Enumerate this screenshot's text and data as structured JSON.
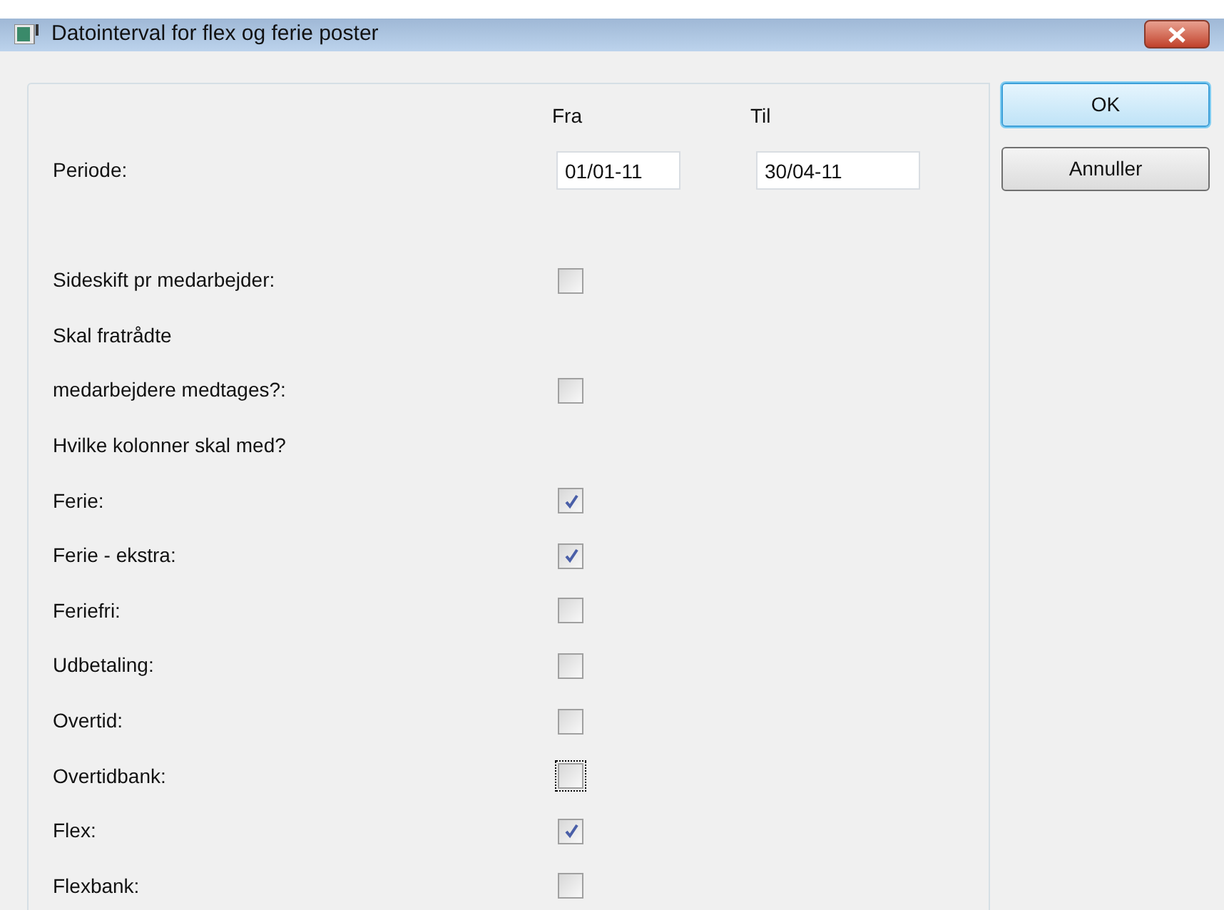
{
  "window": {
    "title": "Datointerval for flex og ferie poster"
  },
  "period": {
    "label": "Periode:",
    "from_header": "Fra",
    "to_header": "Til",
    "from": "01/01-11",
    "to": "30/04-11"
  },
  "rows": [
    {
      "kind": "checkbox",
      "label": "Sideskift pr medarbejder:",
      "checked": false,
      "focused": false
    },
    {
      "kind": "label",
      "label": "Skal fratrådte"
    },
    {
      "kind": "checkbox",
      "label": "medarbejdere medtages?:",
      "checked": false,
      "focused": false
    },
    {
      "kind": "label",
      "label": "Hvilke kolonner skal med?"
    },
    {
      "kind": "checkbox",
      "label": "Ferie:",
      "checked": true,
      "focused": false
    },
    {
      "kind": "checkbox",
      "label": "Ferie - ekstra:",
      "checked": true,
      "focused": false
    },
    {
      "kind": "checkbox",
      "label": "Feriefri:",
      "checked": false,
      "focused": false
    },
    {
      "kind": "checkbox",
      "label": "Udbetaling:",
      "checked": false,
      "focused": false
    },
    {
      "kind": "checkbox",
      "label": "Overtid:",
      "checked": false,
      "focused": false
    },
    {
      "kind": "checkbox",
      "label": "Overtidbank:",
      "checked": false,
      "focused": true
    },
    {
      "kind": "checkbox",
      "label": "Flex:",
      "checked": true,
      "focused": false
    },
    {
      "kind": "checkbox",
      "label": "Flexbank:",
      "checked": false,
      "focused": false
    }
  ],
  "buttons": [
    {
      "label": "OK",
      "default": true
    },
    {
      "label": "Annuller",
      "default": false
    }
  ]
}
